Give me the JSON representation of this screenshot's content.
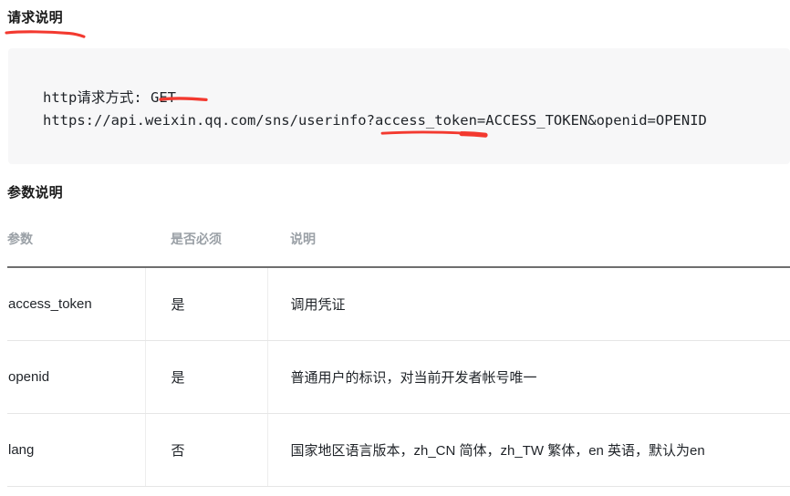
{
  "sections": {
    "request": {
      "heading": "请求说明",
      "code_lines": [
        "http请求方式: GET",
        "https://api.weixin.qq.com/sns/userinfo?access_token=ACCESS_TOKEN&openid=OPENID"
      ]
    },
    "params": {
      "heading": "参数说明",
      "columns": [
        "参数",
        "是否必须",
        "说明"
      ],
      "rows": [
        {
          "name": "access_token",
          "required": "是",
          "description": "调用凭证"
        },
        {
          "name": "openid",
          "required": "是",
          "description": "普通用户的标识，对当前开发者帐号唯一"
        },
        {
          "name": "lang",
          "required": "否",
          "description": "国家地区语言版本，zh_CN 简体，zh_TW 繁体，en 英语，默认为en"
        }
      ]
    }
  },
  "annotations": {
    "color": "#f3392f",
    "marks": [
      {
        "target": "请求说明",
        "type": "underline-stroke"
      },
      {
        "target": "GET",
        "type": "underline-stroke"
      },
      {
        "target": "access_token=ACCESS_TOKEN",
        "type": "underline-stroke"
      }
    ]
  },
  "colors": {
    "code_background": "#f7f7f8",
    "heading_text": "#1a1a1a",
    "table_header_text": "#9aa0a6",
    "body_text": "#1f2328",
    "annotation_red": "#f3392f"
  }
}
